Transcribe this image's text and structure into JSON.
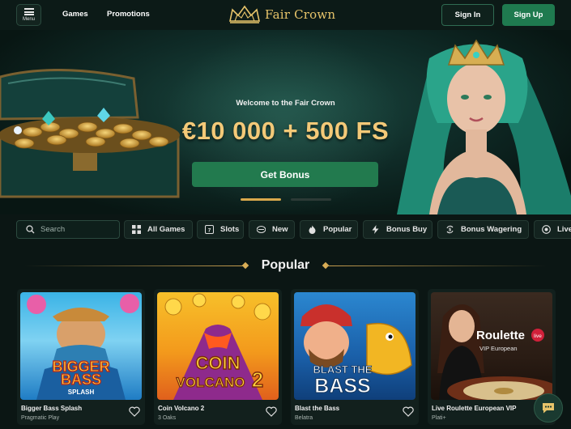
{
  "header": {
    "menu_label": "Menu",
    "nav": [
      "Games",
      "Promotions"
    ],
    "brand": "Fair Crown",
    "sign_in": "Sign In",
    "sign_up": "Sign Up"
  },
  "hero": {
    "welcome": "Welcome to the Fair Crown",
    "headline": "€10 000 + 500 FS",
    "cta": "Get Bonus",
    "slides": 2,
    "active_slide": 1
  },
  "search": {
    "placeholder": "Search"
  },
  "categories": [
    {
      "label": "All Games",
      "icon": "grid-icon"
    },
    {
      "label": "Slots",
      "icon": "slot-777-icon"
    },
    {
      "label": "New",
      "icon": "new-badge-icon"
    },
    {
      "label": "Popular",
      "icon": "flame-icon"
    },
    {
      "label": "Bonus Buy",
      "icon": "lightning-icon"
    },
    {
      "label": "Bonus Wagering",
      "icon": "coin-exchange-icon"
    },
    {
      "label": "Live",
      "icon": "live-chip-icon"
    }
  ],
  "section": {
    "title": "Popular"
  },
  "games": [
    {
      "name": "Bigger Bass Splash",
      "provider": "Pragmatic Play",
      "art_text": [
        "BIGGER",
        "BASS",
        "SPLASH"
      ]
    },
    {
      "name": "Coin Volcano 2",
      "provider": "3 Oaks",
      "art_text": [
        "COIN",
        "VOLCANO",
        "2"
      ]
    },
    {
      "name": "Blast the Bass",
      "provider": "Belatra",
      "art_text": [
        "BLAST THE",
        "BASS"
      ]
    },
    {
      "name": "Live Roulette European VIP",
      "provider": "Plati+",
      "art_text": [
        "Roulette",
        "live",
        "VIP European"
      ]
    }
  ],
  "colors": {
    "accent_green": "#227a4e",
    "gold": "#e7c46a",
    "background": "#0b1614"
  }
}
